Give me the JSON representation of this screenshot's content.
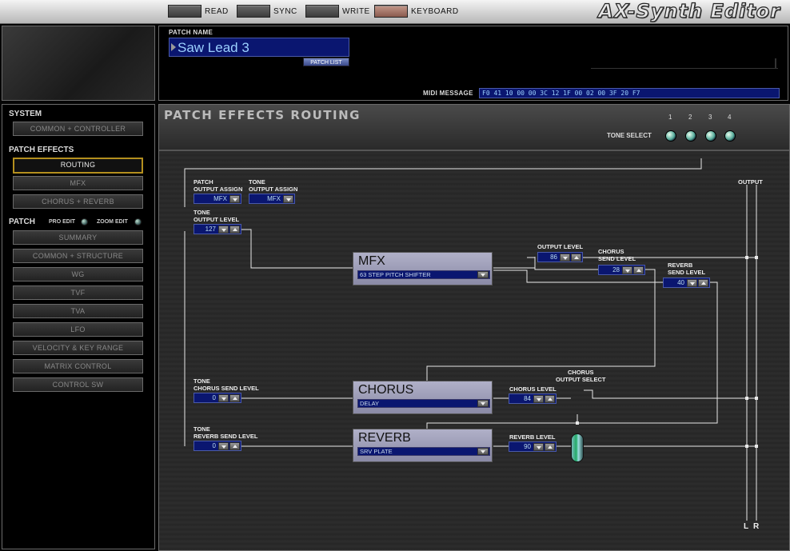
{
  "topbar": {
    "buttons": [
      {
        "label": "READ"
      },
      {
        "label": "SYNC"
      },
      {
        "label": "WRITE"
      },
      {
        "label": "KEYBOARD"
      }
    ],
    "app_title": "AX-Synth Editor"
  },
  "patch": {
    "name_label": "PATCH NAME",
    "name": "Saw Lead 3",
    "patch_list_label": "PATCH LIST",
    "midi_label": "MIDI MESSAGE",
    "midi_message": "F0 41 10 00 00 3C 12 1F 00 02 00 3F 20 F7"
  },
  "nav": {
    "system_title": "SYSTEM",
    "system_items": [
      "COMMON + CONTROLLER"
    ],
    "effects_title": "PATCH EFFECTS",
    "effects_items": [
      "ROUTING",
      "MFX",
      "CHORUS + REVERB"
    ],
    "patch_title": "PATCH",
    "pro_edit": "PRO EDIT",
    "zoom_edit": "ZOOM EDIT",
    "patch_items": [
      "SUMMARY",
      "COMMON + STRUCTURE",
      "WG",
      "TVF",
      "TVA",
      "LFO",
      "VELOCITY & KEY RANGE",
      "MATRIX CONTROL",
      "CONTROL SW"
    ]
  },
  "main": {
    "title": "PATCH EFFECTS ROUTING",
    "tone_select_label": "TONE SELECT",
    "tone_numbers": [
      "1",
      "2",
      "3",
      "4"
    ],
    "output_label": "OUTPUT",
    "left_label": "L",
    "right_label": "R",
    "patch_output_assign": {
      "label1": "PATCH",
      "label2": "OUTPUT ASSIGN",
      "value": "MFX"
    },
    "tone_output_assign": {
      "label1": "TONE",
      "label2": "OUTPUT ASSIGN",
      "value": "MFX"
    },
    "tone_output_level": {
      "label1": "TONE",
      "label2": "OUTPUT LEVEL",
      "value": "127"
    },
    "mfx": {
      "name": "MFX",
      "type": "63 STEP PITCH SHIFTER"
    },
    "mfx_output_level": {
      "label": "OUTPUT LEVEL",
      "value": "86"
    },
    "mfx_chorus_send": {
      "label1": "CHORUS",
      "label2": "SEND LEVEL",
      "value": "28"
    },
    "mfx_reverb_send": {
      "label1": "REVERB",
      "label2": "SEND LEVEL",
      "value": "40"
    },
    "tone_chorus_send": {
      "label1": "TONE",
      "label2": "CHORUS SEND LEVEL",
      "value": "0"
    },
    "chorus": {
      "name": "CHORUS",
      "type": "DELAY"
    },
    "chorus_level": {
      "label": "CHORUS LEVEL",
      "value": "84"
    },
    "chorus_output_select": {
      "label1": "CHORUS",
      "label2": "OUTPUT SELECT"
    },
    "tone_reverb_send": {
      "label1": "TONE",
      "label2": "REVERB SEND LEVEL",
      "value": "0"
    },
    "reverb": {
      "name": "REVERB",
      "type": "SRV PLATE"
    },
    "reverb_level": {
      "label": "REVERB LEVEL",
      "value": "90"
    }
  }
}
